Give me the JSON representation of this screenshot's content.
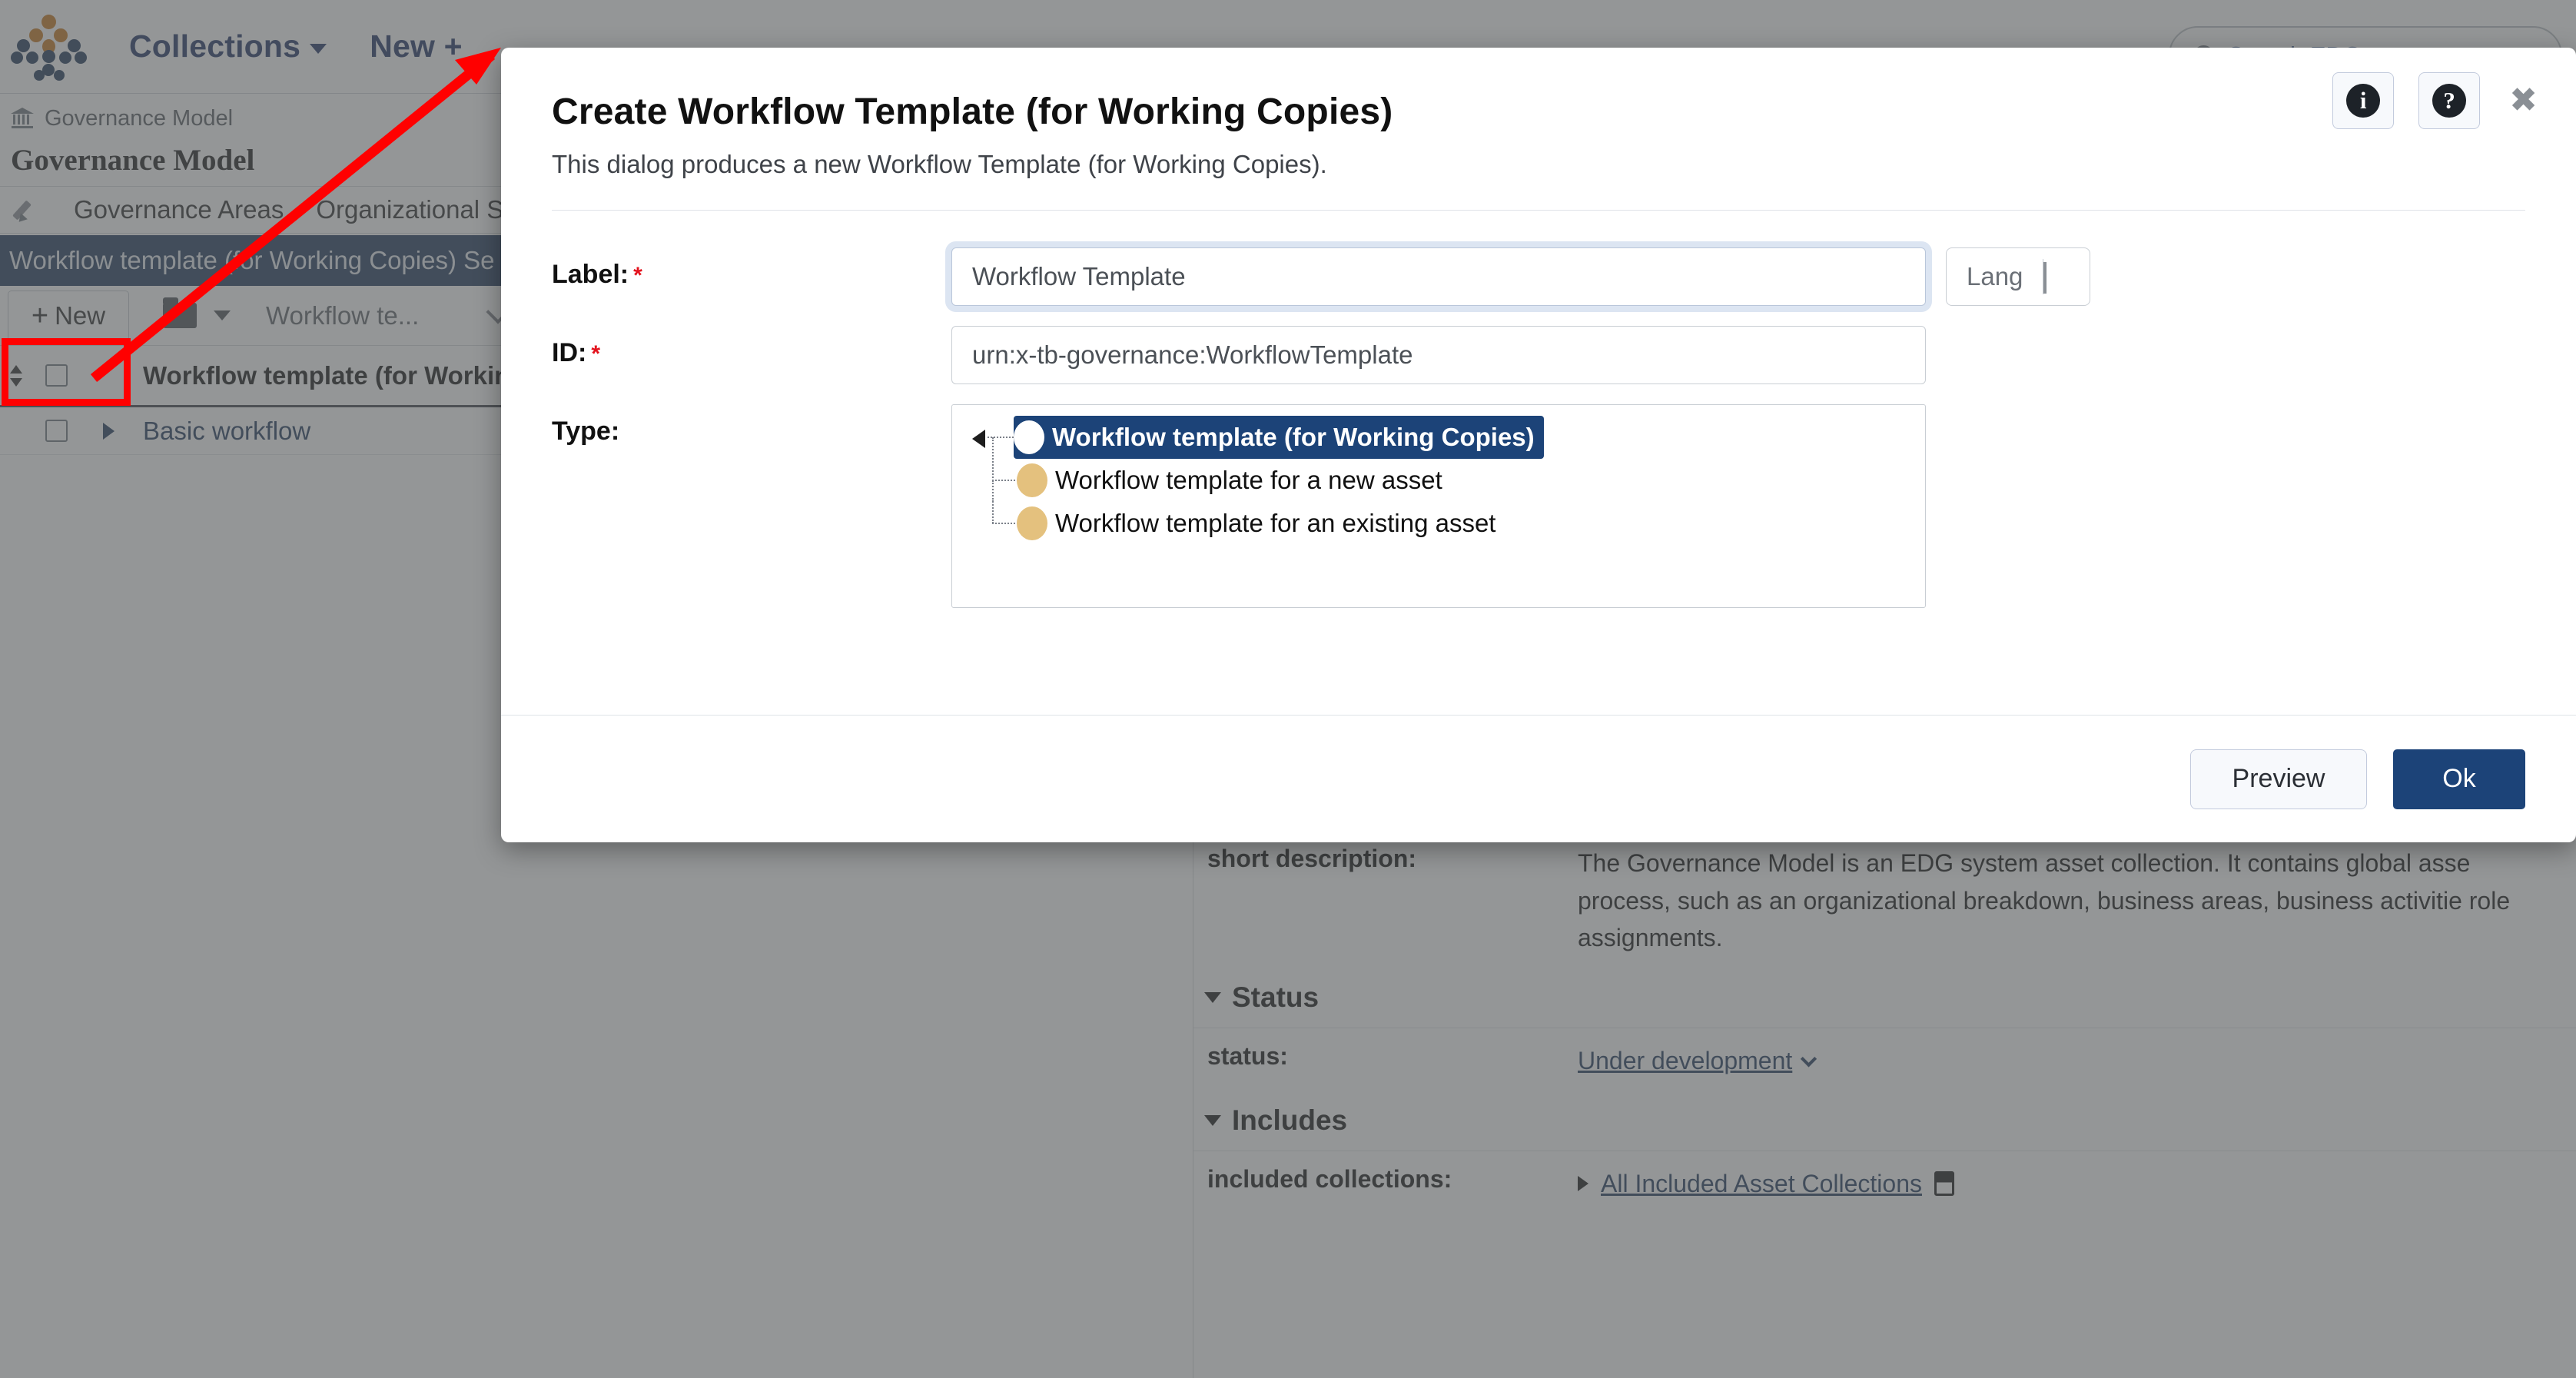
{
  "app": {
    "nav": {
      "logo_alt": "TopBraid EDG logo",
      "collections_label": "Collections",
      "new_label": "New +",
      "search_placeholder": "Search EDG"
    },
    "breadcrumb": {
      "icon": "bank-icon",
      "text": "Governance Model"
    },
    "page_title": "Governance Model",
    "tabs": [
      {
        "label": "Governance Areas"
      },
      {
        "label": "Organizational S"
      }
    ],
    "section_header": "Workflow template (for Working Copies) Se",
    "toolbar": {
      "new_button": "+ New",
      "folder_icon": "folder-icon",
      "selector_value": "Workflow te..."
    },
    "table": {
      "columns": [
        "Workflow template (for Workin"
      ],
      "rows": [
        {
          "name": "Basic workflow"
        }
      ]
    },
    "details": {
      "short_description_label": "short description:",
      "short_description_value": "The Governance Model is an EDG system asset collection. It contains global asse process, such as an organizational breakdown, business areas, business activitie role assignments.",
      "status_section": "Status",
      "status_label": "status:",
      "status_value": "Under development",
      "includes_section": "Includes",
      "included_collections_label": "included collections:",
      "included_collections_value": "All Included Asset Collections"
    }
  },
  "dialog": {
    "title": "Create Workflow Template (for Working Copies)",
    "subtitle": "This dialog produces a new Workflow Template (for Working Copies).",
    "info_icon": "i",
    "help_icon": "?",
    "close_icon": "✖",
    "fields": {
      "label_label": "Label:",
      "label_required": "*",
      "label_value": "Workflow Template",
      "lang_label": "Lang",
      "id_label": "ID:",
      "id_required": "*",
      "id_value": "urn:x-tb-governance:WorkflowTemplate",
      "type_label": "Type:"
    },
    "type_tree": [
      {
        "label": "Workflow template (for Working Copies)",
        "selected": true,
        "level": 0,
        "icon": "white-circle"
      },
      {
        "label": "Workflow template for a new asset",
        "selected": false,
        "level": 1,
        "icon": "tan-circle"
      },
      {
        "label": "Workflow template for an existing asset",
        "selected": false,
        "level": 1,
        "icon": "tan-circle"
      }
    ],
    "footer": {
      "preview_label": "Preview",
      "ok_label": "Ok"
    }
  },
  "annotation": {
    "arrow_color": "#ff0000",
    "highlight_color": "#ff0000",
    "target": "+ New"
  },
  "colors": {
    "brand_navy": "#1c3559",
    "accent_orange": "#c4751a",
    "selected_blue": "#1c4378",
    "tree_node_tan": "#e4c17e",
    "required_red": "#e3121d",
    "scrim": "rgba(88,90,92,0.64)"
  }
}
